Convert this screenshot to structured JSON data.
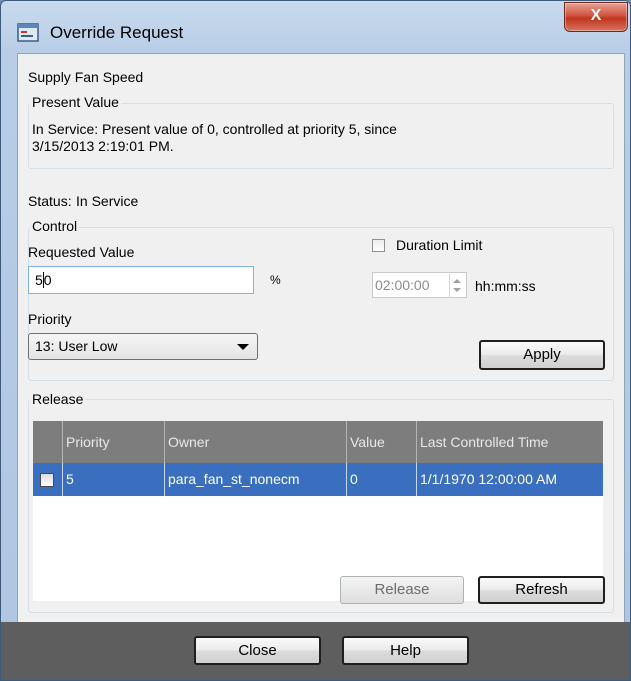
{
  "window": {
    "title": "Override Request",
    "close_glyph": "X"
  },
  "point_name": "Supply Fan Speed",
  "present_value": {
    "title": "Present Value",
    "line1": "In Service: Present value of 0, controlled at priority 5, since",
    "line2": "3/15/2013 2:19:01 PM."
  },
  "status": {
    "label": "Status:",
    "value": "In Service"
  },
  "control": {
    "title": "Control",
    "requested_value_label": "Requested Value",
    "requested_value_before_caret": "5",
    "requested_value_after_caret": "0",
    "unit": "%",
    "duration_limit_label": "Duration Limit",
    "duration_limit_checked": false,
    "duration_value": "02:00:00",
    "duration_unit": "hh:mm:ss",
    "priority_label": "Priority",
    "priority_selected": "13: User Low",
    "apply_label": "Apply"
  },
  "release": {
    "title": "Release",
    "columns": [
      "Priority",
      "Owner",
      "Value",
      "Last Controlled Time"
    ],
    "rows": [
      {
        "checked": false,
        "priority": "5",
        "owner": "para_fan_st_nonecm",
        "value": "0",
        "last_controlled_time": "1/1/1970 12:00:00 AM"
      }
    ],
    "release_label": "Release",
    "refresh_label": "Refresh"
  },
  "footer": {
    "close_label": "Close",
    "help_label": "Help"
  },
  "colors": {
    "selection_row": "#3a6fc0",
    "grid_header": "#7d7d7d",
    "footer_bg": "#5e5e5e",
    "title_bar": "#b8cde6",
    "close_button": "#c0351d"
  }
}
